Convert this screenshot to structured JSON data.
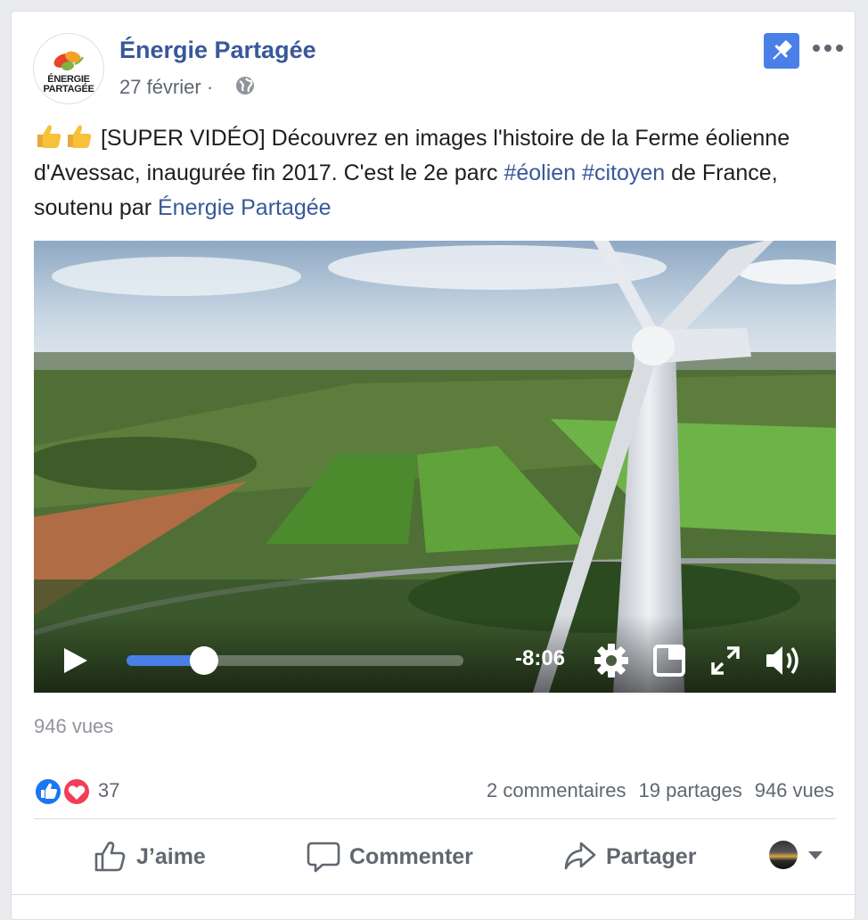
{
  "post": {
    "page_name": "Énergie Partagée",
    "logo_text_line1": "ÉNERGIE",
    "logo_text_line2": "PARTAGÉE",
    "date": "27 février",
    "date_separator": "·",
    "privacy_icon": "globe-icon",
    "pin_icon": "pin-icon",
    "more_icon": "more-horizontal-icon",
    "text": {
      "part1": " [SUPER VIDÉO] Découvrez en images l'histoire de la Ferme éolienne d'Avessac, inaugurée fin 2017. C'est le 2e parc ",
      "hashtag1": "#éolien",
      "space": " ",
      "hashtag2": "#citoyen",
      "part2": " de France, soutenu par ",
      "mention": "Énergie Partagée"
    },
    "emoji": [
      "thumbs-up-emoji",
      "thumbs-up-emoji"
    ]
  },
  "video": {
    "time_remaining": "-8:06",
    "progress": 0.23,
    "controls": [
      "play-icon",
      "settings-gear-icon",
      "pip-icon",
      "fullscreen-icon",
      "volume-icon"
    ]
  },
  "views_label": "946 vues",
  "engagement": {
    "reactions": [
      "like-reaction-icon",
      "love-reaction-icon"
    ],
    "reaction_count": "37",
    "comments": "2 commentaires",
    "shares": "19 partages",
    "views": "946 vues"
  },
  "actions": {
    "like": "J’aime",
    "comment": "Commenter",
    "share": "Partager"
  },
  "colors": {
    "link": "#385898",
    "secondary_text": "#606770",
    "pin_button": "#4a7fe8",
    "like_blue": "#1877f2",
    "love_red": "#f33e58"
  }
}
